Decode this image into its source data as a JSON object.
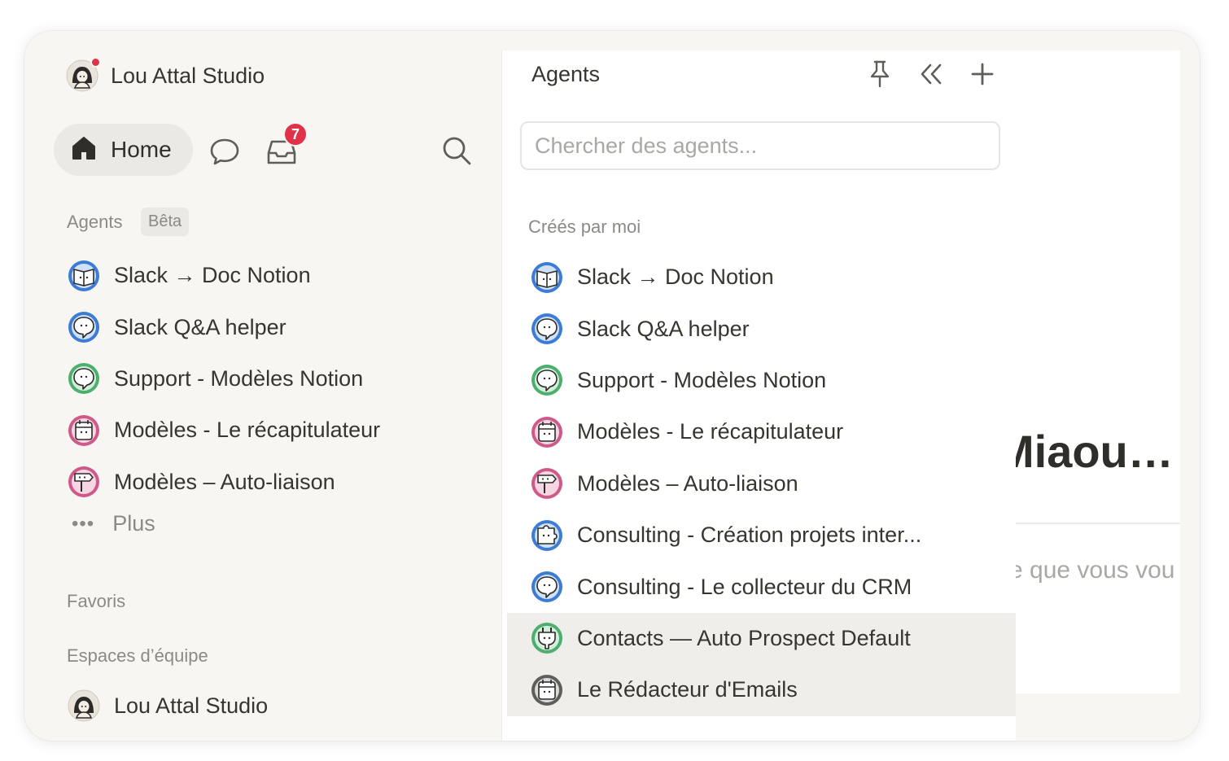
{
  "workspace": {
    "name": "Lou Attal Studio"
  },
  "nav": {
    "home_label": "Home",
    "inbox_count": "7"
  },
  "sidebar": {
    "agents_label": "Agents",
    "beta_label": "Bêta",
    "agents": [
      {
        "label": "Slack → Doc Notion",
        "icon": "book-agent-icon",
        "color": "#3d7cd4"
      },
      {
        "label": "Slack Q&A helper",
        "icon": "speech-agent-icon",
        "color": "#3d7cd4"
      },
      {
        "label": "Support - Modèles Notion",
        "icon": "speech-agent-icon",
        "color": "#4caf6e"
      },
      {
        "label": "Modèles - Le récapitulateur",
        "icon": "calendar-agent-icon",
        "color": "#cf5a8a"
      },
      {
        "label": "Modèles – Auto-liaison",
        "icon": "signpost-agent-icon",
        "color": "#cf5a8a"
      }
    ],
    "more_label": "Plus",
    "favorites_label": "Favoris",
    "teamspaces_label": "Espaces d’équipe",
    "teamspace_name": "Lou Attal Studio"
  },
  "panel": {
    "title": "Agents",
    "search_placeholder": "Chercher des agents...",
    "section_label": "Créés par moi",
    "agents": [
      {
        "label": "Slack → Doc Notion",
        "icon": "book-agent-icon",
        "color": "#3d7cd4"
      },
      {
        "label": "Slack Q&A helper",
        "icon": "speech-agent-icon",
        "color": "#3d7cd4"
      },
      {
        "label": "Support - Modèles Notion",
        "icon": "speech-agent-icon",
        "color": "#4caf6e"
      },
      {
        "label": "Modèles - Le récapitulateur",
        "icon": "calendar-agent-icon",
        "color": "#cf5a8a"
      },
      {
        "label": "Modèles – Auto-liaison",
        "icon": "signpost-agent-icon",
        "color": "#cf5a8a"
      },
      {
        "label": "Consulting - Création projets inter...",
        "icon": "puzzle-agent-icon",
        "color": "#3d7cd4"
      },
      {
        "label": "Consulting - Le collecteur du CRM",
        "icon": "speech-agent-icon",
        "color": "#3d7cd4"
      },
      {
        "label": "Contacts — Auto Prospect Default",
        "icon": "plug-agent-icon",
        "color": "#4caf6e"
      },
      {
        "label": "Le Rédacteur d'Emails",
        "icon": "calendar-agent-icon",
        "color": "#5f5e5a"
      }
    ]
  },
  "page": {
    "title_fragment": "Miaou… (",
    "subtitle_fragment": "e que vous vou"
  }
}
